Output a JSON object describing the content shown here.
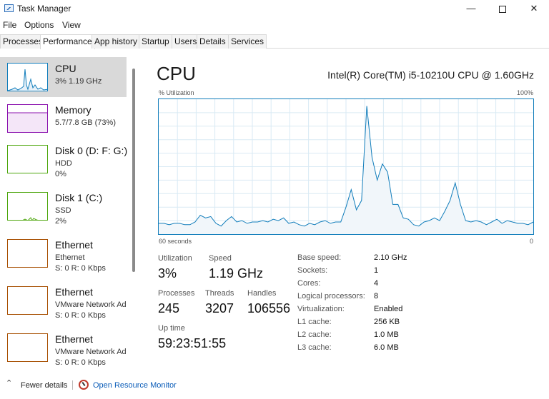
{
  "window": {
    "title": "Task Manager",
    "minimize_glyph": "—",
    "close_glyph": "✕"
  },
  "menu": [
    "File",
    "Options",
    "View"
  ],
  "tabs": [
    "Processes",
    "Performance",
    "App history",
    "Startup",
    "Users",
    "Details",
    "Services"
  ],
  "active_tab": "Performance",
  "sidebar": {
    "items": [
      {
        "title": "CPU",
        "sub1": "3%  1.19 GHz",
        "sub2": "",
        "color": "#117dbb",
        "selected": true
      },
      {
        "title": "Memory",
        "sub1": "5.7/7.8 GB (73%)",
        "sub2": "",
        "color": "#8b12ae",
        "selected": false
      },
      {
        "title": "Disk 0 (D: F: G:)",
        "sub1": "HDD",
        "sub2": "0%",
        "color": "#4da60c",
        "selected": false
      },
      {
        "title": "Disk 1 (C:)",
        "sub1": "SSD",
        "sub2": "2%",
        "color": "#4da60c",
        "selected": false
      },
      {
        "title": "Ethernet",
        "sub1": "Ethernet",
        "sub2": "S: 0  R: 0 Kbps",
        "color": "#a74f01",
        "selected": false
      },
      {
        "title": "Ethernet",
        "sub1": "VMware Network Ad",
        "sub2": "S: 0  R: 0 Kbps",
        "color": "#a74f01",
        "selected": false
      },
      {
        "title": "Ethernet",
        "sub1": "VMware Network Ad",
        "sub2": "S: 0  R: 0 Kbps",
        "color": "#a74f01",
        "selected": false
      }
    ]
  },
  "main": {
    "title": "CPU",
    "model": "Intel(R) Core(TM) i5-10210U CPU @ 1.60GHz",
    "util_label": "% Utilization",
    "util_max": "100%",
    "axis_left": "60 seconds",
    "axis_right": "0",
    "graph_color": "#117dbb",
    "graph_fill": "#f1f6fa",
    "grid_color": "#d9eaf4",
    "utilization_history": [
      8,
      8,
      7,
      8,
      8,
      7,
      7,
      9,
      14,
      12,
      13,
      8,
      6,
      10,
      13,
      9,
      10,
      8,
      9,
      9,
      10,
      9,
      11,
      10,
      12,
      8,
      9,
      7,
      6,
      8,
      7,
      9,
      10,
      8,
      9,
      9,
      20,
      33,
      18,
      25,
      95,
      57,
      40,
      52,
      46,
      22,
      22,
      12,
      11,
      7,
      6,
      9,
      10,
      12,
      10,
      17,
      25,
      38,
      22,
      10,
      9,
      10,
      9,
      7,
      9,
      11,
      8,
      10,
      9,
      8,
      8,
      7,
      9
    ],
    "stats": {
      "utilization_label": "Utilization",
      "utilization_value": "3%",
      "speed_label": "Speed",
      "speed_value": "1.19 GHz",
      "processes_label": "Processes",
      "processes_value": "245",
      "threads_label": "Threads",
      "threads_value": "3207",
      "handles_label": "Handles",
      "handles_value": "106556",
      "uptime_label": "Up time",
      "uptime_value": "59:23:51:55"
    },
    "info": [
      {
        "key": "Base speed:",
        "value": "2.10 GHz"
      },
      {
        "key": "Sockets:",
        "value": "1"
      },
      {
        "key": "Cores:",
        "value": "4"
      },
      {
        "key": "Logical processors:",
        "value": "8"
      },
      {
        "key": "Virtualization:",
        "value": "Enabled"
      },
      {
        "key": "L1 cache:",
        "value": "256 KB"
      },
      {
        "key": "L2 cache:",
        "value": "1.0 MB"
      },
      {
        "key": "L3 cache:",
        "value": "6.0 MB"
      }
    ]
  },
  "footer": {
    "fewer_details": "Fewer details",
    "open_resource_monitor": "Open Resource Monitor"
  }
}
